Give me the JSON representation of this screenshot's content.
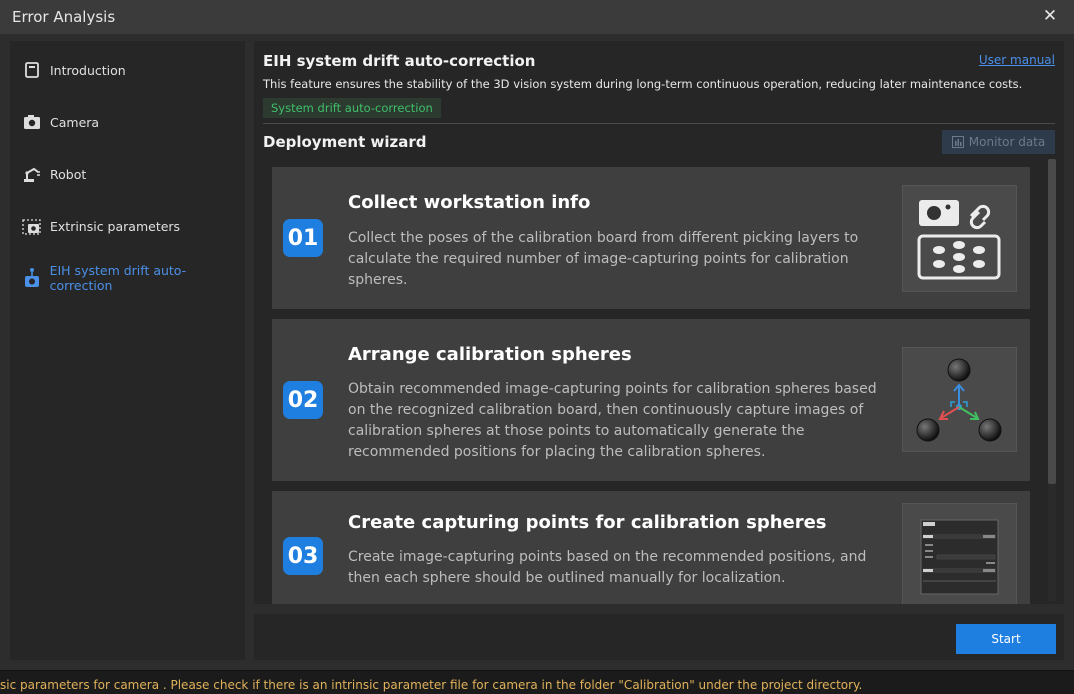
{
  "window": {
    "title": "Error Analysis",
    "close_icon": "close-icon"
  },
  "sidebar": {
    "items": [
      {
        "label": "Introduction",
        "icon": "book-icon"
      },
      {
        "label": "Camera",
        "icon": "camera-icon"
      },
      {
        "label": "Robot",
        "icon": "robot-arm-icon"
      },
      {
        "label": "Extrinsic parameters",
        "icon": "extrinsic-camera-icon"
      },
      {
        "label": "EIH system drift auto-correction",
        "icon": "eih-drift-icon",
        "active": true
      }
    ]
  },
  "header": {
    "title": "EIH system drift auto-correction",
    "manual_link": "User manual",
    "description": "This feature ensures the stability of the 3D vision system during long-term continuous operation, reducing later maintenance costs.",
    "tag": "System drift auto-correction"
  },
  "wizard": {
    "title": "Deployment wizard",
    "monitor_button": "Monitor data",
    "steps": [
      {
        "number": "01",
        "title": "Collect workstation info",
        "description": "Collect the poses of the calibration board from different picking layers to calculate the required number of image-capturing points for calibration spheres."
      },
      {
        "number": "02",
        "title": "Arrange calibration spheres",
        "description": "Obtain recommended image-capturing points for calibration spheres based on the recognized calibration board, then continuously capture images of calibration spheres at those points to automatically generate the recommended positions for placing the calibration spheres."
      },
      {
        "number": "03",
        "title": "Create capturing points for calibration spheres",
        "description": "Create image-capturing points based on the recommended positions, and then each sphere should be outlined manually for localization."
      }
    ]
  },
  "footer": {
    "start_button": "Start"
  },
  "status_bar": {
    "message": "sic parameters for camera . Please check if there is an intrinsic parameter file for camera  in the folder \"Calibration\" under the project directory."
  },
  "colors": {
    "accent": "#1f7fe0",
    "link": "#4b90e8",
    "tag_text": "#3fbf6a",
    "warning": "#e0b25a"
  }
}
